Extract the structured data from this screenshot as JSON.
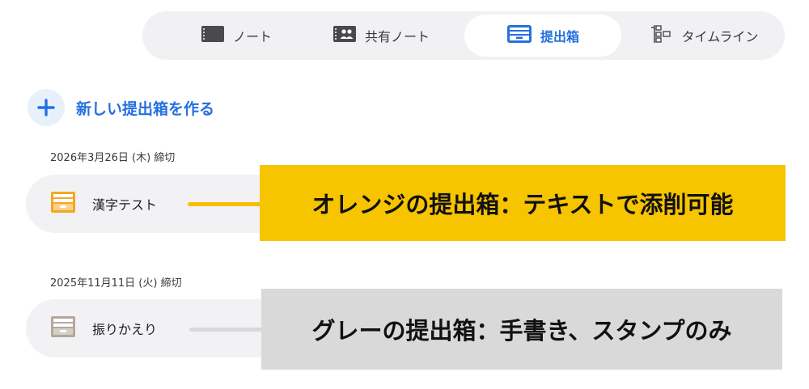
{
  "tabs": [
    {
      "label": "ノート",
      "icon": "notebook-icon",
      "active": false
    },
    {
      "label": "共有ノート",
      "icon": "shared-notebook-icon",
      "active": false
    },
    {
      "label": "提出箱",
      "icon": "inbox-tray-icon",
      "active": true
    },
    {
      "label": "タイムライン",
      "icon": "timeline-icon",
      "active": false
    }
  ],
  "create": {
    "label": "新しい提出箱を作る",
    "icon": "plus-icon"
  },
  "boxes": [
    {
      "date": "2026年3月26日 (木) 締切",
      "label": "漢字テスト",
      "icon": "orange-box-icon",
      "color": "#f5a623"
    },
    {
      "date": "2025年11月11日 (火) 締切",
      "label": "振りかえり",
      "icon": "gray-box-icon",
      "color": "#b3a89a"
    }
  ],
  "annotations": [
    {
      "text": "オレンジの提出箱：テキストで添削可能",
      "color": "#f7c400"
    },
    {
      "text": "グレーの提出箱：手書き、スタンプのみ",
      "color": "#d9d9d9"
    }
  ],
  "colors": {
    "accent": "#2470e0",
    "tab_bar_bg": "#f1f1f4",
    "row_bg": "#f2f2f5"
  }
}
